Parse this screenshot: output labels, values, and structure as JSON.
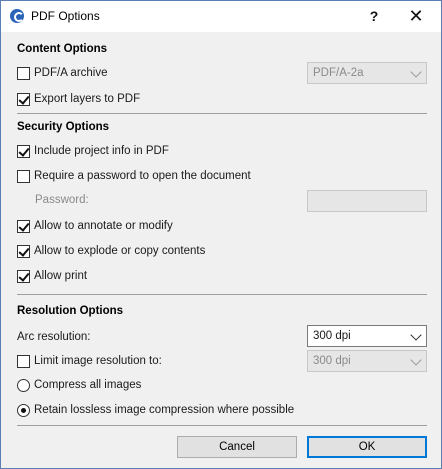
{
  "window": {
    "title": "PDF Options",
    "help_label": "?",
    "close_label": "✕"
  },
  "content": {
    "title": "Content Options",
    "pdfa_label": "PDF/A archive",
    "pdfa_checked": false,
    "pdfa_select": "PDF/A-2a",
    "export_layers_label": "Export layers to PDF",
    "export_layers_checked": true
  },
  "security": {
    "title": "Security Options",
    "include_info_label": "Include project info in PDF",
    "require_password_label": "Require a password to open the document",
    "password_label": "Password:",
    "password_value": "",
    "annotate_label": "Allow to annotate or modify",
    "explode_label": "Allow to explode or copy contents",
    "print_label": "Allow print"
  },
  "resolution": {
    "title": "Resolution Options",
    "arc_label": "Arc resolution:",
    "arc_value": "300 dpi",
    "limit_label": "Limit image resolution to:",
    "limit_value": "300 dpi",
    "compress_label": "Compress all images",
    "retain_label": "Retain lossless image compression where possible"
  },
  "buttons": {
    "cancel": "Cancel",
    "ok": "OK"
  },
  "colors": {
    "accent": "#0078d7",
    "window_border": "#5a7fb3",
    "background": "#f0f0f0"
  },
  "icons": {
    "app": "archicad-icon",
    "help": "help-icon",
    "close": "close-icon"
  }
}
